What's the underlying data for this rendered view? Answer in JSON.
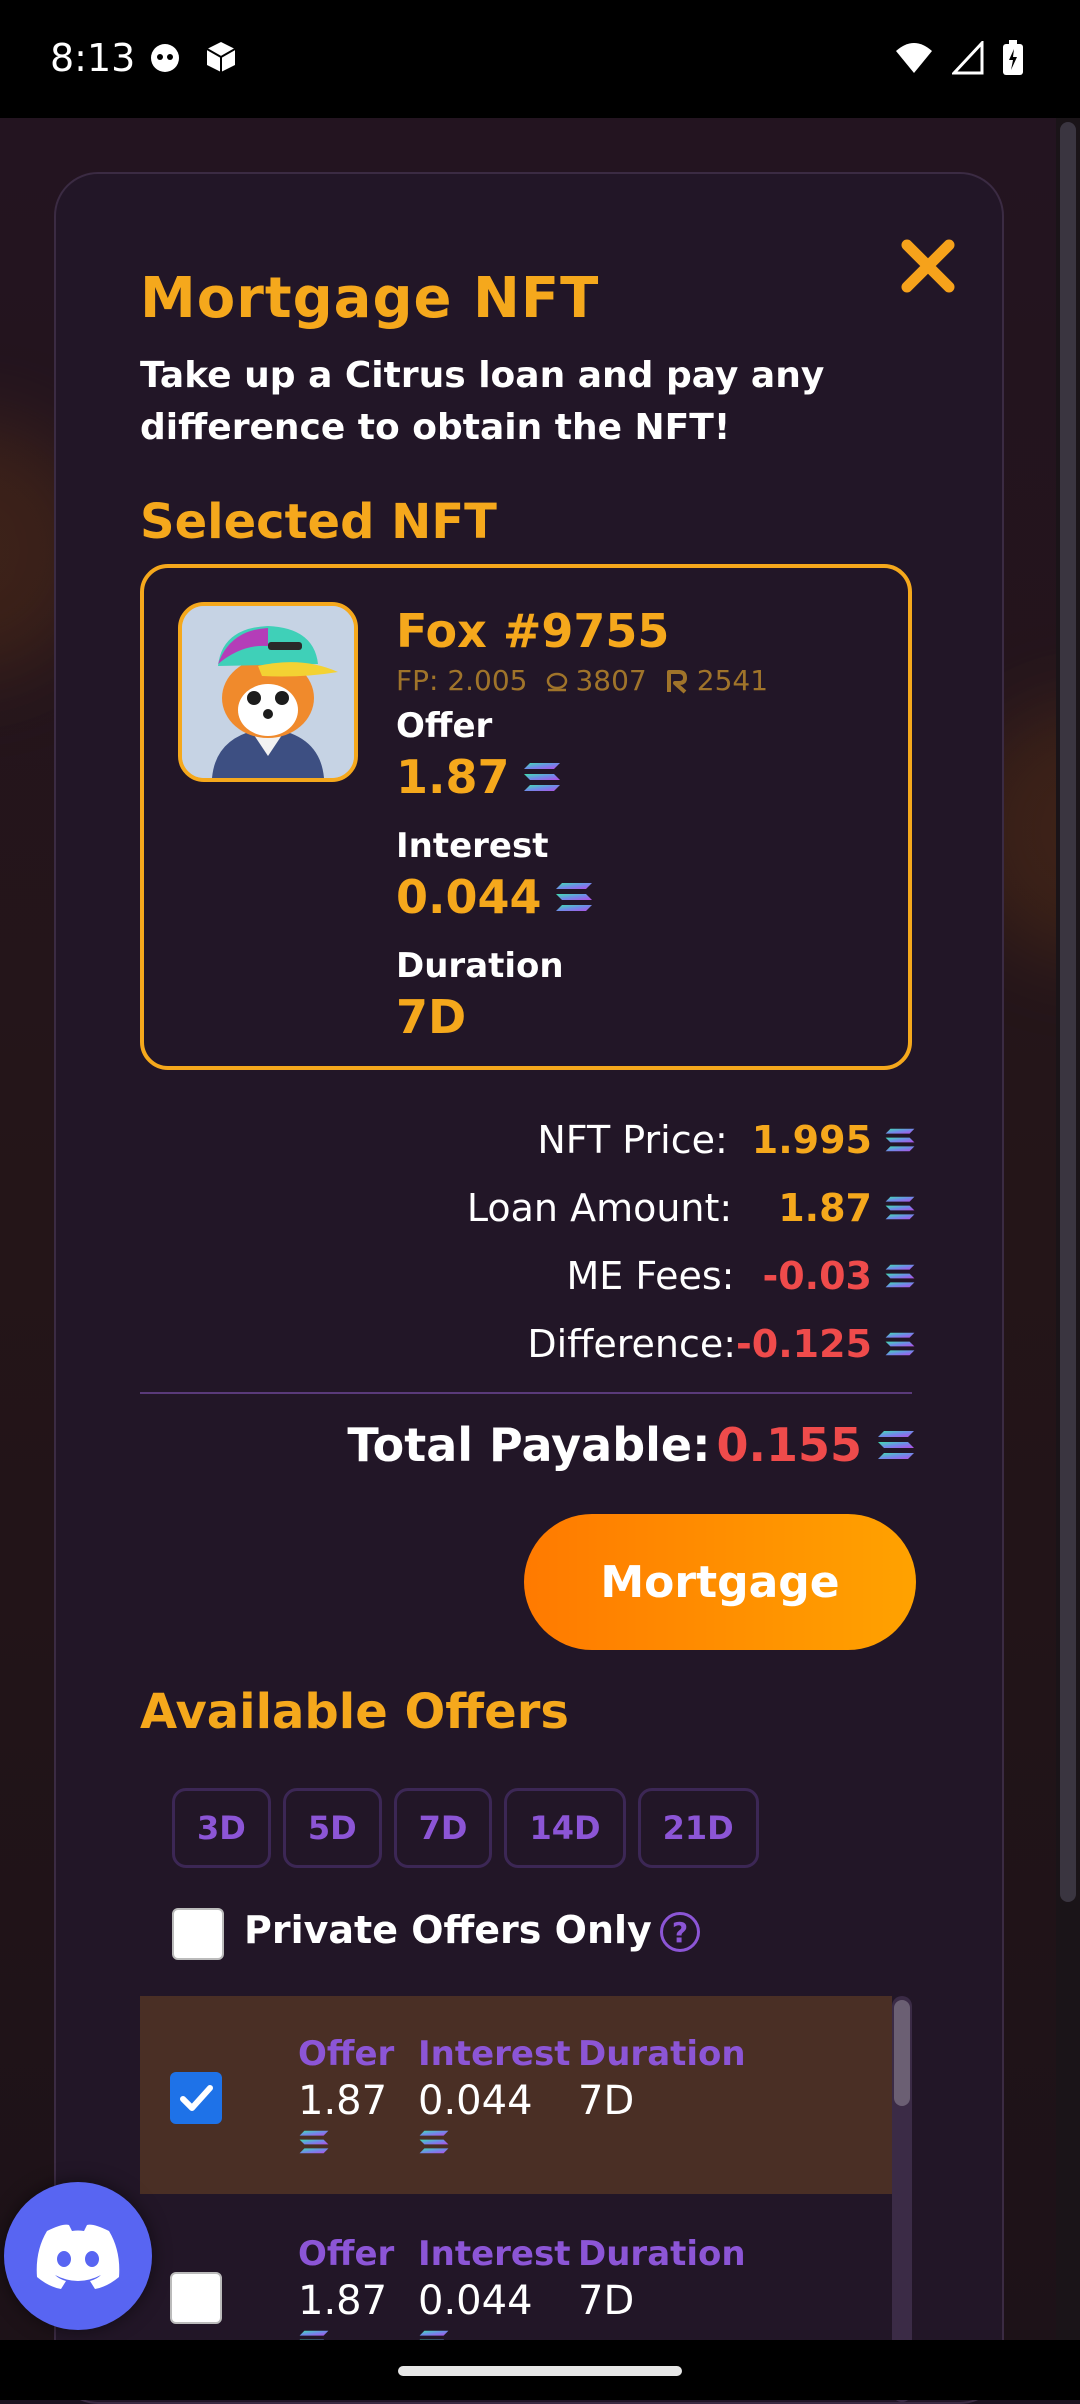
{
  "status_bar": {
    "time": "8:13"
  },
  "modal": {
    "title": "Mortgage NFT",
    "subtitle": "Take up a Citrus loan and pay any difference to obtain the NFT!",
    "selected_section_title": "Selected NFT",
    "nft": {
      "name": "Fox #9755",
      "fp": "FP: 2.005",
      "stat_a": "3807",
      "stat_b": "2541",
      "offer_label": "Offer",
      "offer_value": "1.87",
      "interest_label": "Interest",
      "interest_value": "0.044",
      "duration_label": "Duration",
      "duration_value": "7D"
    },
    "summary": {
      "nft_price_label": "NFT Price:",
      "nft_price": "1.995",
      "loan_amount_label": "Loan Amount:",
      "loan_amount": "1.87",
      "me_fees_label": "ME Fees:",
      "me_fees": "-0.03",
      "difference_label": "Difference:",
      "difference": "-0.125",
      "total_label": "Total Payable:",
      "total": "0.155"
    },
    "mortgage_button": "Mortgage",
    "offers_section_title": "Available Offers",
    "duration_filters": [
      "3D",
      "5D",
      "7D",
      "14D",
      "21D"
    ],
    "private_offers_label": "Private Offers Only",
    "help_symbol": "?",
    "offer_headers": {
      "offer": "Offer",
      "interest": "Interest",
      "duration": "Duration"
    },
    "offers": [
      {
        "offer": "1.87",
        "interest": "0.044",
        "duration": "7D",
        "selected": true
      },
      {
        "offer": "1.87",
        "interest": "0.044",
        "duration": "7D",
        "selected": false
      }
    ]
  },
  "colors": {
    "accent": "#f5a81c",
    "negative": "#ef4b4b",
    "purple": "#8c55d6",
    "modal_bg": "#221627"
  },
  "icons": [
    "close-icon",
    "solana-icon",
    "help-icon",
    "discord-icon",
    "checkmark-icon"
  ]
}
